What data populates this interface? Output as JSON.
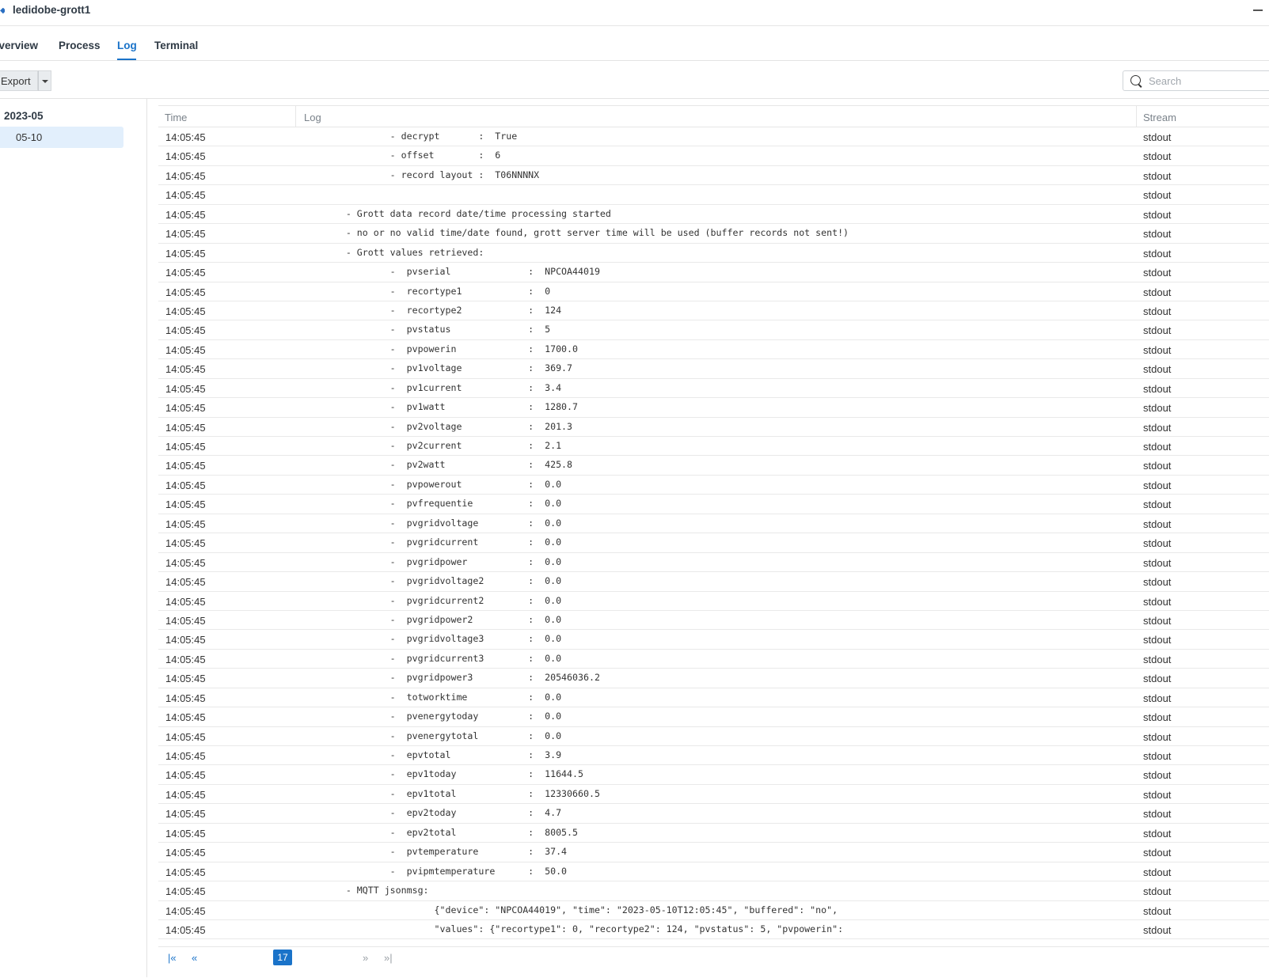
{
  "window": {
    "title": "ledidobe-grott1"
  },
  "tabs": [
    {
      "label": "Overview"
    },
    {
      "label": "Process"
    },
    {
      "label": "Log"
    },
    {
      "label": "Terminal"
    }
  ],
  "active_tab": "Log",
  "toolbar": {
    "export_label": "Export",
    "search_placeholder": "Search"
  },
  "tree": {
    "month": "2023-05",
    "day": "05-10"
  },
  "table": {
    "headers": {
      "time": "Time",
      "log": "Log",
      "stream": "Stream"
    },
    "rows": [
      {
        "time": "14:05:45",
        "log": "                - decrypt       :  True",
        "stream": "stdout"
      },
      {
        "time": "14:05:45",
        "log": "                - offset        :  6",
        "stream": "stdout"
      },
      {
        "time": "14:05:45",
        "log": "                - record layout :  T06NNNNX",
        "stream": "stdout"
      },
      {
        "time": "14:05:45",
        "log": "",
        "stream": "stdout"
      },
      {
        "time": "14:05:45",
        "log": "        - Grott data record date/time processing started",
        "stream": "stdout"
      },
      {
        "time": "14:05:45",
        "log": "        - no or no valid time/date found, grott server time will be used (buffer records not sent!)",
        "stream": "stdout"
      },
      {
        "time": "14:05:45",
        "log": "        - Grott values retrieved:",
        "stream": "stdout"
      },
      {
        "time": "14:05:45",
        "log": "                -  pvserial              :  NPCOA44019",
        "stream": "stdout"
      },
      {
        "time": "14:05:45",
        "log": "                -  recortype1            :  0",
        "stream": "stdout"
      },
      {
        "time": "14:05:45",
        "log": "                -  recortype2            :  124",
        "stream": "stdout"
      },
      {
        "time": "14:05:45",
        "log": "                -  pvstatus              :  5",
        "stream": "stdout"
      },
      {
        "time": "14:05:45",
        "log": "                -  pvpowerin             :  1700.0",
        "stream": "stdout"
      },
      {
        "time": "14:05:45",
        "log": "                -  pv1voltage            :  369.7",
        "stream": "stdout"
      },
      {
        "time": "14:05:45",
        "log": "                -  pv1current            :  3.4",
        "stream": "stdout"
      },
      {
        "time": "14:05:45",
        "log": "                -  pv1watt               :  1280.7",
        "stream": "stdout"
      },
      {
        "time": "14:05:45",
        "log": "                -  pv2voltage            :  201.3",
        "stream": "stdout"
      },
      {
        "time": "14:05:45",
        "log": "                -  pv2current            :  2.1",
        "stream": "stdout"
      },
      {
        "time": "14:05:45",
        "log": "                -  pv2watt               :  425.8",
        "stream": "stdout"
      },
      {
        "time": "14:05:45",
        "log": "                -  pvpowerout            :  0.0",
        "stream": "stdout"
      },
      {
        "time": "14:05:45",
        "log": "                -  pvfrequentie          :  0.0",
        "stream": "stdout"
      },
      {
        "time": "14:05:45",
        "log": "                -  pvgridvoltage         :  0.0",
        "stream": "stdout"
      },
      {
        "time": "14:05:45",
        "log": "                -  pvgridcurrent         :  0.0",
        "stream": "stdout"
      },
      {
        "time": "14:05:45",
        "log": "                -  pvgridpower           :  0.0",
        "stream": "stdout"
      },
      {
        "time": "14:05:45",
        "log": "                -  pvgridvoltage2        :  0.0",
        "stream": "stdout"
      },
      {
        "time": "14:05:45",
        "log": "                -  pvgridcurrent2        :  0.0",
        "stream": "stdout"
      },
      {
        "time": "14:05:45",
        "log": "                -  pvgridpower2          :  0.0",
        "stream": "stdout"
      },
      {
        "time": "14:05:45",
        "log": "                -  pvgridvoltage3        :  0.0",
        "stream": "stdout"
      },
      {
        "time": "14:05:45",
        "log": "                -  pvgridcurrent3        :  0.0",
        "stream": "stdout"
      },
      {
        "time": "14:05:45",
        "log": "                -  pvgridpower3          :  20546036.2",
        "stream": "stdout"
      },
      {
        "time": "14:05:45",
        "log": "                -  totworktime           :  0.0",
        "stream": "stdout"
      },
      {
        "time": "14:05:45",
        "log": "                -  pvenergytoday         :  0.0",
        "stream": "stdout"
      },
      {
        "time": "14:05:45",
        "log": "                -  pvenergytotal         :  0.0",
        "stream": "stdout"
      },
      {
        "time": "14:05:45",
        "log": "                -  epvtotal              :  3.9",
        "stream": "stdout"
      },
      {
        "time": "14:05:45",
        "log": "                -  epv1today             :  11644.5",
        "stream": "stdout"
      },
      {
        "time": "14:05:45",
        "log": "                -  epv1total             :  12330660.5",
        "stream": "stdout"
      },
      {
        "time": "14:05:45",
        "log": "                -  epv2today             :  4.7",
        "stream": "stdout"
      },
      {
        "time": "14:05:45",
        "log": "                -  epv2total             :  8005.5",
        "stream": "stdout"
      },
      {
        "time": "14:05:45",
        "log": "                -  pvtemperature         :  37.4",
        "stream": "stdout"
      },
      {
        "time": "14:05:45",
        "log": "                -  pvipmtemperature      :  50.0",
        "stream": "stdout"
      },
      {
        "time": "14:05:45",
        "log": "        - MQTT jsonmsg:",
        "stream": "stdout"
      },
      {
        "time": "14:05:45",
        "log": "                        {\"device\": \"NPCOA44019\", \"time\": \"2023-05-10T12:05:45\", \"buffered\": \"no\",",
        "stream": "stdout"
      },
      {
        "time": "14:05:45",
        "log": "                        \"values\": {\"recortype1\": 0, \"recortype2\": 124, \"pvstatus\": 5, \"pvpowerin\":",
        "stream": "stdout"
      }
    ]
  },
  "pagination": {
    "first": "|«",
    "prev": "«",
    "current": "17",
    "next": "»",
    "last": "»|"
  }
}
